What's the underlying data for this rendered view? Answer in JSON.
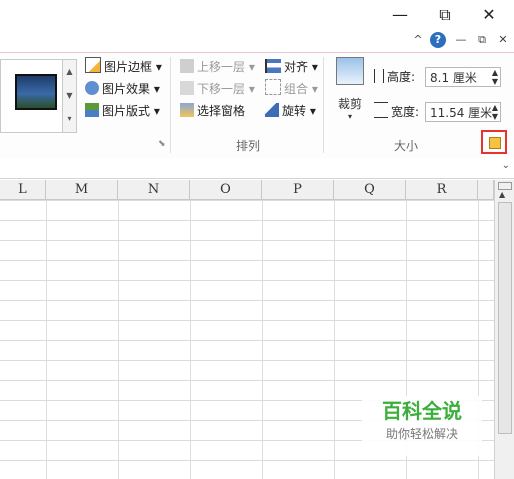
{
  "window": {
    "minimize": "—",
    "restore": "⧉",
    "close": "✕"
  },
  "ribbon_controls": {
    "collapse": "^",
    "help": "?",
    "min": "—",
    "restore": "⧉",
    "close": "✕"
  },
  "picture_styles": {
    "border": "图片边框",
    "effects": "图片效果",
    "layout": "图片版式"
  },
  "arrange": {
    "bring_forward": "上移一层",
    "send_backward": "下移一层",
    "selection_pane": "选择窗格",
    "align": "对齐",
    "group": "组合",
    "rotate": "旋转",
    "label": "排列"
  },
  "size": {
    "crop": "裁剪",
    "height_label": "高度:",
    "height_value": "8.1 厘米",
    "width_label": "宽度:",
    "width_value": "11.54 厘米",
    "label": "大小"
  },
  "columns": [
    "L",
    "M",
    "N",
    "O",
    "P",
    "Q",
    "R"
  ],
  "watermark": {
    "title": "百科全说",
    "subtitle": "助你轻松解决"
  }
}
